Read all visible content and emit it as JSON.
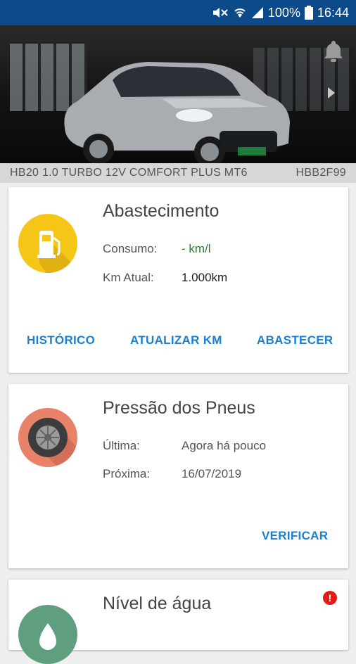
{
  "status_bar": {
    "battery": "100%",
    "time": "16:44",
    "icons": [
      "mute-icon",
      "wifi-icon",
      "signal-icon",
      "battery-icon"
    ]
  },
  "vehicle": {
    "model": "HB20 1.0 TURBO 12V COMFORT PLUS MT6",
    "plate": "HBB2F99",
    "header_icons": [
      "bell-icon",
      "play-arrow-icon"
    ]
  },
  "cards": {
    "fuel": {
      "title": "Abastecimento",
      "icon": "fuel-pump-icon",
      "consumption_label": "Consumo:",
      "consumption_value": "- km/l",
      "km_label": "Km Atual:",
      "km_value": "1.000km",
      "actions": {
        "history": "HISTÓRICO",
        "update_km": "ATUALIZAR KM",
        "refuel": "ABASTECER"
      }
    },
    "tires": {
      "title": "Pressão dos Pneus",
      "icon": "tire-icon",
      "last_label": "Última:",
      "last_value": "Agora há pouco",
      "next_label": "Próxima:",
      "next_value": "16/07/2019",
      "actions": {
        "check": "VERIFICAR"
      }
    },
    "water": {
      "title": "Nível de água",
      "icon": "water-drop-icon",
      "alert_icon": "alert-icon",
      "alert_symbol": "!"
    }
  },
  "colors": {
    "status_bar": "#0d4a8a",
    "accent": "#1b7fcf",
    "fuel_circle": "#f5c518",
    "tire_circle": "#e8836a",
    "water_circle": "#5f9f80",
    "consumption_value": "#2e7d32",
    "alert": "#e21b1b"
  }
}
